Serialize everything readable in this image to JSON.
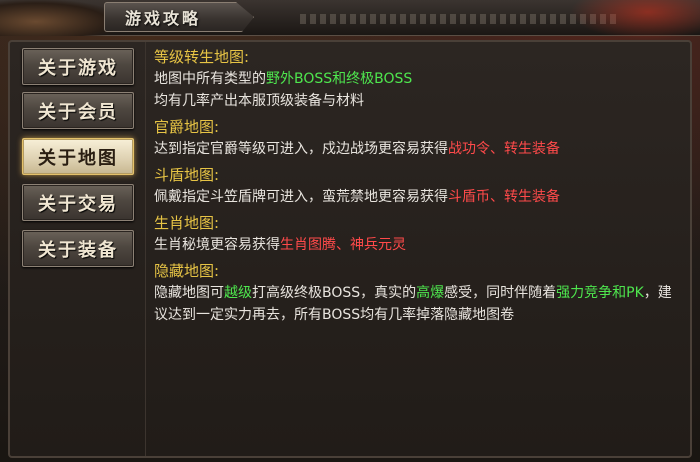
{
  "header": {
    "title": "游戏攻略"
  },
  "sidebar": {
    "items": [
      {
        "label": "关于游戏",
        "active": false
      },
      {
        "label": "关于会员",
        "active": false
      },
      {
        "label": "关于地图",
        "active": true
      },
      {
        "label": "关于交易",
        "active": false
      },
      {
        "label": "关于装备",
        "active": false
      }
    ]
  },
  "sections": [
    {
      "title": "等级转生地图:",
      "line1": {
        "a": "地图中所有类型的",
        "b": "野外BOSS和终极BOSS"
      },
      "line2": "均有几率产出本服顶级装备与材料"
    },
    {
      "title": "官爵地图:",
      "line1": {
        "a": "达到指定官爵等级可进入，戍边战场更容易获得",
        "b": "战功令、转生装备"
      }
    },
    {
      "title": "斗盾地图:",
      "line1": {
        "a": "佩戴指定斗笠盾牌可进入，蛮荒禁地更容易获得",
        "b": "斗盾币、转生装备"
      }
    },
    {
      "title": "生肖地图:",
      "line1": {
        "a": "生肖秘境更容易获得",
        "b": "生肖图腾、神兵元灵"
      }
    },
    {
      "title": "隐藏地图:",
      "p1": "隐藏地图可",
      "p2": "越级",
      "p3": "打高级终极BOSS，真实的",
      "p4": "高爆",
      "p5": "感受，同时伴随着",
      "p6": "强力竞争和PK",
      "p7": "，建议达到一定实力再去，所有BOSS均有几率掉落隐藏地图卷"
    }
  ],
  "colors": {
    "title": "#e7c445",
    "green": "#4ee64e",
    "red": "#ff4a4a",
    "text": "#e8e4de"
  }
}
